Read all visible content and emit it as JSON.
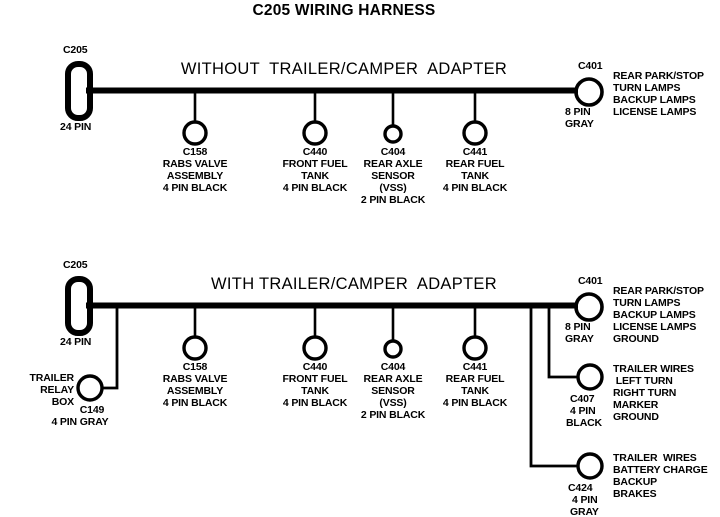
{
  "document": {
    "title": "C205 WIRING HARNESS"
  },
  "sections": [
    {
      "id": "without-adapter",
      "title": "WITHOUT  TRAILER/CAMPER  ADAPTER",
      "source_connector": {
        "id": "C205",
        "pins": "24 PIN"
      },
      "end_connector": {
        "id": "C401",
        "pins": "8 PIN",
        "color": "GRAY",
        "circuits": [
          "REAR PARK/STOP",
          "TURN LAMPS",
          "BACKUP LAMPS",
          "LICENSE LAMPS"
        ]
      },
      "drops": [
        {
          "id": "C158",
          "lines": [
            "RABS VALVE",
            "ASSEMBLY",
            "4 PIN BLACK"
          ]
        },
        {
          "id": "C440",
          "lines": [
            "FRONT FUEL",
            "TANK",
            "4 PIN BLACK"
          ]
        },
        {
          "id": "C404",
          "lines": [
            "REAR AXLE",
            "SENSOR",
            "(VSS)",
            "2 PIN BLACK"
          ]
        },
        {
          "id": "C441",
          "lines": [
            "REAR FUEL",
            "TANK",
            "4 PIN BLACK"
          ]
        }
      ]
    },
    {
      "id": "with-adapter",
      "title": "WITH TRAILER/CAMPER  ADAPTER",
      "source_connector": {
        "id": "C205",
        "pins": "24 PIN"
      },
      "end_connector": {
        "id": "C401",
        "pins": "8 PIN",
        "color": "GRAY",
        "circuits": [
          "REAR PARK/STOP",
          "TURN LAMPS",
          "BACKUP LAMPS",
          "LICENSE LAMPS",
          "GROUND"
        ]
      },
      "relay_box": {
        "name_lines": [
          "TRAILER",
          "RELAY",
          "BOX"
        ],
        "id": "C149",
        "spec": "4 PIN GRAY"
      },
      "drops": [
        {
          "id": "C158",
          "lines": [
            "RABS VALVE",
            "ASSEMBLY",
            "4 PIN BLACK"
          ]
        },
        {
          "id": "C440",
          "lines": [
            "FRONT FUEL",
            "TANK",
            "4 PIN BLACK"
          ]
        },
        {
          "id": "C404",
          "lines": [
            "REAR AXLE",
            "SENSOR",
            "(VSS)",
            "2 PIN BLACK"
          ]
        },
        {
          "id": "C441",
          "lines": [
            "REAR FUEL",
            "TANK",
            "4 PIN BLACK"
          ]
        }
      ],
      "trailer_connectors": [
        {
          "id": "C407",
          "pins": "4 PIN",
          "color": "BLACK",
          "circuits": [
            "TRAILER WIRES",
            " LEFT TURN",
            "RIGHT TURN",
            "MARKER",
            "GROUND"
          ]
        },
        {
          "id": "C424",
          "pins": "4 PIN",
          "color": "GRAY",
          "circuits": [
            "TRAILER  WIRES",
            "BATTERY CHARGE",
            "BACKUP",
            "BRAKES"
          ]
        }
      ]
    }
  ],
  "style": {
    "wire_color": "#000000",
    "background": "#ffffff"
  }
}
